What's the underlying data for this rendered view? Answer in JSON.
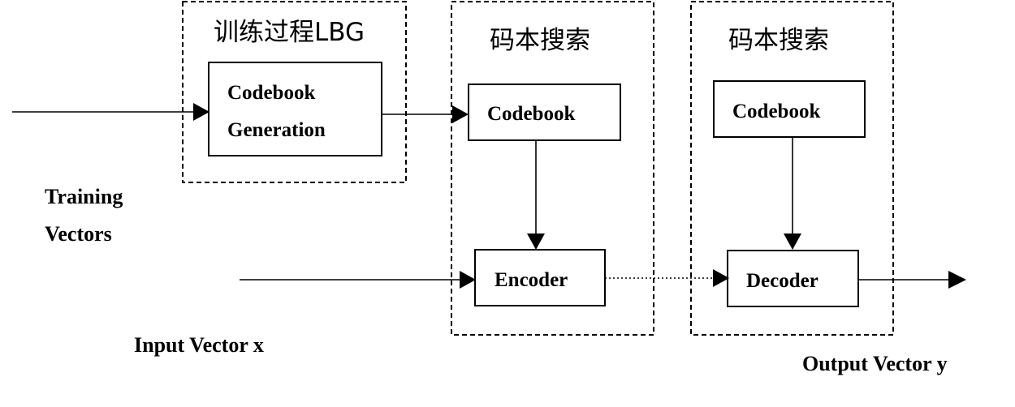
{
  "groups": {
    "training": {
      "title": "训练过程LBG"
    },
    "search": {
      "title": "码本搜索"
    },
    "decode": {
      "title": "码本搜索"
    }
  },
  "blocks": {
    "codebook_generation": {
      "line1": "Codebook",
      "line2": "Generation"
    },
    "codebook_search": {
      "label": "Codebook"
    },
    "encoder": {
      "label": "Encoder"
    },
    "codebook_decode": {
      "label": "Codebook"
    },
    "decoder": {
      "label": "Decoder"
    }
  },
  "labels": {
    "training_vectors_line1": "Training",
    "training_vectors_line2": "Vectors",
    "input_vector": "Input Vector x",
    "output_vector": "Output Vector y"
  }
}
